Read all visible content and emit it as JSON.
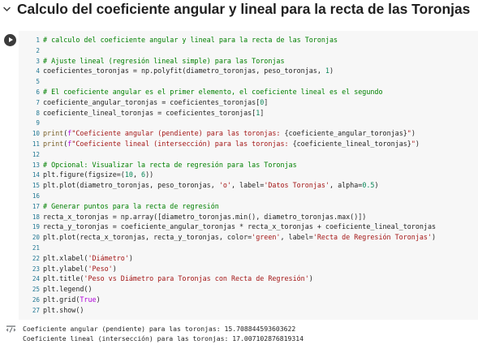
{
  "section": {
    "title": "Calculo del coeficiente angular y lineal para la recta de las Toronjas"
  },
  "code_cell": {
    "lines": [
      {
        "n": "1",
        "t": [
          [
            "comment",
            "# calculo del coeficiente angular y lineal para la recta de las Toronjas"
          ]
        ]
      },
      {
        "n": "2",
        "t": []
      },
      {
        "n": "3",
        "t": [
          [
            "comment",
            "# Ajuste lineal (regresión lineal simple) para las Toronjas"
          ]
        ]
      },
      {
        "n": "4",
        "t": [
          [
            "plain",
            "coeficientes_toronjas = np.polyfit(diametro_toronjas, peso_toronjas, "
          ],
          [
            "number",
            "1"
          ],
          [
            "plain",
            ")"
          ]
        ]
      },
      {
        "n": "5",
        "t": []
      },
      {
        "n": "6",
        "t": [
          [
            "comment",
            "# El coeficiente angular es el primer elemento, el coeficiente lineal es el segundo"
          ]
        ]
      },
      {
        "n": "7",
        "t": [
          [
            "plain",
            "coeficiente_angular_toronjas = coeficientes_toronjas["
          ],
          [
            "number",
            "0"
          ],
          [
            "plain",
            "]"
          ]
        ]
      },
      {
        "n": "8",
        "t": [
          [
            "plain",
            "coeficiente_lineal_toronjas = coeficientes_toronjas["
          ],
          [
            "number",
            "1"
          ],
          [
            "plain",
            "]"
          ]
        ]
      },
      {
        "n": "9",
        "t": []
      },
      {
        "n": "10",
        "t": [
          [
            "builtin",
            "print"
          ],
          [
            "plain",
            "("
          ],
          [
            "keyword",
            "f"
          ],
          [
            "string",
            "\"Coeficiente angular (pendiente) para las toronjas: "
          ],
          [
            "plain",
            "{coeficiente_angular_toronjas}"
          ],
          [
            "string",
            "\""
          ],
          [
            "plain",
            ")"
          ]
        ]
      },
      {
        "n": "11",
        "t": [
          [
            "builtin",
            "print"
          ],
          [
            "plain",
            "("
          ],
          [
            "keyword",
            "f"
          ],
          [
            "string",
            "\"Coeficiente lineal (intersección) para las toronjas: "
          ],
          [
            "plain",
            "{coeficiente_lineal_toronjas}"
          ],
          [
            "string",
            "\""
          ],
          [
            "plain",
            ")"
          ]
        ]
      },
      {
        "n": "12",
        "t": []
      },
      {
        "n": "13",
        "t": [
          [
            "comment",
            "# Opcional: Visualizar la recta de regresión para las Toronjas"
          ]
        ]
      },
      {
        "n": "14",
        "t": [
          [
            "plain",
            "plt.figure(figsize=("
          ],
          [
            "number",
            "10"
          ],
          [
            "plain",
            ", "
          ],
          [
            "number",
            "6"
          ],
          [
            "plain",
            "))"
          ]
        ]
      },
      {
        "n": "15",
        "t": [
          [
            "plain",
            "plt.plot(diametro_toronjas, peso_toronjas, "
          ],
          [
            "string",
            "'o'"
          ],
          [
            "plain",
            ", label="
          ],
          [
            "string",
            "'Datos Toronjas'"
          ],
          [
            "plain",
            ", alpha="
          ],
          [
            "number",
            "0.5"
          ],
          [
            "plain",
            ")"
          ]
        ]
      },
      {
        "n": "16",
        "t": []
      },
      {
        "n": "17",
        "t": [
          [
            "comment",
            "# Generar puntos para la recta de regresión"
          ]
        ]
      },
      {
        "n": "18",
        "t": [
          [
            "plain",
            "recta_x_toronjas = np.array([diametro_toronjas.min(), diametro_toronjas.max()])"
          ]
        ]
      },
      {
        "n": "19",
        "t": [
          [
            "plain",
            "recta_y_toronjas = coeficiente_angular_toronjas * recta_x_toronjas + coeficiente_lineal_toronjas"
          ]
        ]
      },
      {
        "n": "20",
        "t": [
          [
            "plain",
            "plt.plot(recta_x_toronjas, recta_y_toronjas, color="
          ],
          [
            "string",
            "'green'"
          ],
          [
            "plain",
            ", label="
          ],
          [
            "string",
            "'Recta de Regresión Toronjas'"
          ],
          [
            "plain",
            ")"
          ]
        ]
      },
      {
        "n": "21",
        "t": []
      },
      {
        "n": "22",
        "t": [
          [
            "plain",
            "plt.xlabel("
          ],
          [
            "string",
            "'Diámetro'"
          ],
          [
            "plain",
            ")"
          ]
        ]
      },
      {
        "n": "23",
        "t": [
          [
            "plain",
            "plt.ylabel("
          ],
          [
            "string",
            "'Peso'"
          ],
          [
            "plain",
            ")"
          ]
        ]
      },
      {
        "n": "24",
        "t": [
          [
            "plain",
            "plt.title("
          ],
          [
            "string",
            "'Peso vs Diámetro para Toronjas con Recta de Regresión'"
          ],
          [
            "plain",
            ")"
          ]
        ]
      },
      {
        "n": "25",
        "t": [
          [
            "plain",
            "plt.legend()"
          ]
        ]
      },
      {
        "n": "26",
        "t": [
          [
            "plain",
            "plt.grid("
          ],
          [
            "keyword",
            "True"
          ],
          [
            "plain",
            ")"
          ]
        ]
      },
      {
        "n": "27",
        "t": [
          [
            "plain",
            "plt.show()"
          ]
        ]
      }
    ]
  },
  "output": {
    "lines": [
      "Coeficiente angular (pendiente) para las toronjas: 15.708844593603622",
      "Coeficiente lineal (intersección) para las toronjas: 17.007102876819314"
    ]
  },
  "colors": {
    "comment": "#008000",
    "keyword": "#af00db",
    "string": "#a31515",
    "number": "#098658",
    "builtin": "#795e26",
    "line_number": "#237893",
    "code_background": "#f7f7f7",
    "run_button": "#3c3c3c"
  },
  "icons": {
    "section_toggle": "chevron-down-icon",
    "run": "play-icon",
    "output_toggle": "output-toggle-icon"
  }
}
